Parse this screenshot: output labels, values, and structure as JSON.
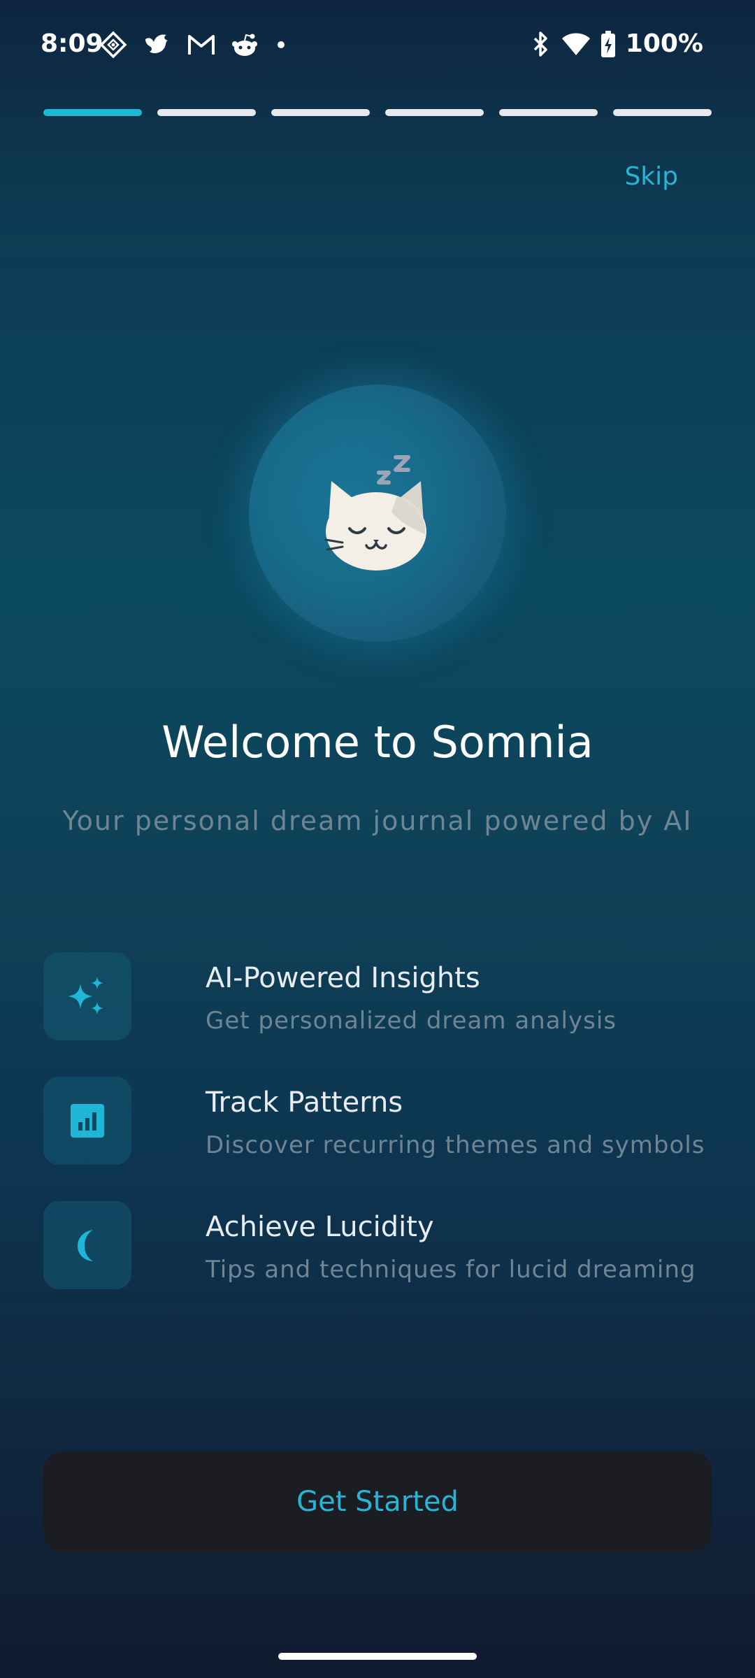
{
  "status_bar": {
    "time": "8:09",
    "battery": "100%",
    "notification_icons": [
      "diamond-icon",
      "bird-icon",
      "gmail-icon",
      "reddit-icon",
      "dot-icon"
    ],
    "system_icons": [
      "bluetooth-icon",
      "wifi-icon",
      "battery-icon"
    ]
  },
  "onboarding": {
    "steps_total": 6,
    "current_step": 1,
    "skip_label": "Skip",
    "hero_icon": "sleeping-cat-icon",
    "title": "Welcome to Somnia",
    "subtitle": "Your personal dream journal powered by AI",
    "features": [
      {
        "icon": "sparkles-icon",
        "title": "AI-Powered Insights",
        "description": "Get personalized dream analysis"
      },
      {
        "icon": "chart-icon",
        "title": "Track Patterns",
        "description": "Discover recurring themes and symbols"
      },
      {
        "icon": "moon-icon",
        "title": "Achieve Lucidity",
        "description": "Tips and techniques for lucid dreaming"
      }
    ],
    "cta_label": "Get Started"
  },
  "colors": {
    "accent": "#27b5d6",
    "progress_active": "#1fb6d8",
    "progress_inactive": "#e6e9ee",
    "button_bg": "#1c1d23",
    "muted_text": "#6f8593"
  }
}
